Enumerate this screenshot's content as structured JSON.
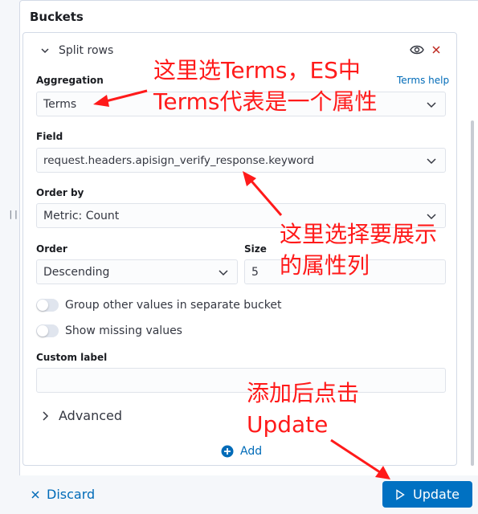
{
  "section": {
    "title": "Buckets"
  },
  "bucket": {
    "name": "Split rows"
  },
  "aggregation": {
    "label": "Aggregation",
    "help_link": "Terms help",
    "value": "Terms"
  },
  "field": {
    "label": "Field",
    "value": "request.headers.apisign_verify_response.keyword"
  },
  "order_by": {
    "label": "Order by",
    "value": "Metric: Count"
  },
  "order": {
    "label": "Order",
    "value": "Descending"
  },
  "size": {
    "label": "Size",
    "value": "5"
  },
  "toggles": {
    "group_other": "Group other values in separate bucket",
    "show_missing": "Show missing values"
  },
  "custom_label": {
    "label": "Custom label",
    "value": ""
  },
  "advanced": {
    "label": "Advanced"
  },
  "add": {
    "label": "Add"
  },
  "footer": {
    "discard_label": "Discard",
    "update_label": "Update"
  },
  "annotations": {
    "terms_line1": "这里选Terms，ES中",
    "terms_line2": "Terms代表是一个属性",
    "field_line1": "这里选择要展示",
    "field_line2": "的属性列",
    "update_line1": "添加后点击",
    "update_line2": "Update"
  },
  "colors": {
    "annotation": "#ff1a1a",
    "primary": "#0071c2",
    "link": "#006bb8"
  }
}
